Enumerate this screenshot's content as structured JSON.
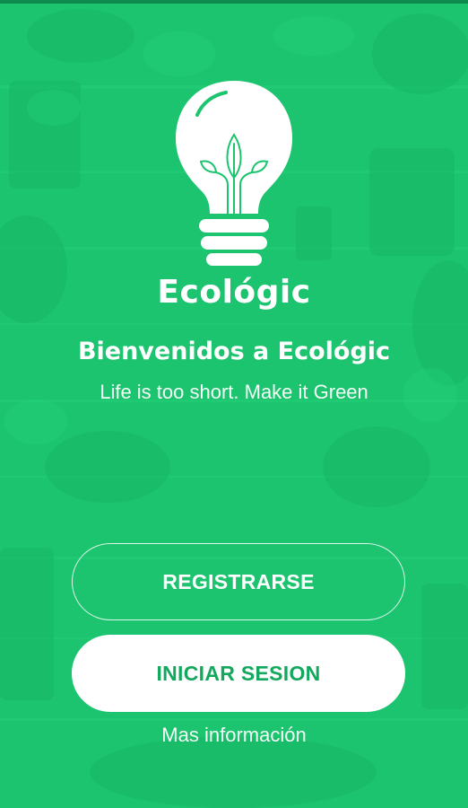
{
  "app": {
    "brand_name": "Ecológic",
    "welcome_title": "Bienvenidos a Ecológic",
    "tagline": "Life is too short. Make it Green"
  },
  "actions": {
    "register_label": "REGISTRARSE",
    "login_label": "INICIAR SESION",
    "more_info_label": "Mas información"
  },
  "icons": {
    "logo": "lightbulb-plant-icon"
  },
  "colors": {
    "background": "#1cc46f",
    "accent_text": "#12a85d",
    "white": "#ffffff"
  }
}
